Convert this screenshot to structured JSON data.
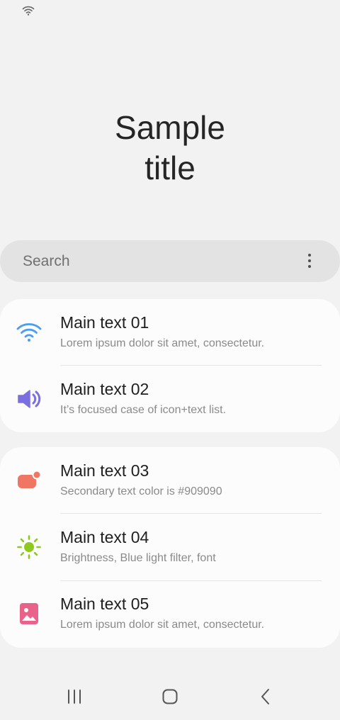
{
  "header": {
    "title_line1": "Sample",
    "title_line2": "title"
  },
  "search": {
    "placeholder": "Search",
    "more_icon": "more-vert-icon"
  },
  "lists": [
    {
      "items": [
        {
          "icon": "wifi-icon",
          "icon_color": "#4a9df0",
          "main": "Main text 01",
          "sub": "Lorem ipsum dolor sit amet, consectetur."
        },
        {
          "icon": "volume-icon",
          "icon_color": "#7b6fe0",
          "main": "Main text 02",
          "sub": "It’s focused case of icon+text list."
        }
      ]
    },
    {
      "items": [
        {
          "icon": "notification-badge-icon",
          "icon_color": "#f07563",
          "main": "Main text 03",
          "sub": "Secondary text color is #909090"
        },
        {
          "icon": "brightness-icon",
          "icon_color": "#8fc91e",
          "main": "Main text 04",
          "sub": "Brightness, Blue light filter, font"
        },
        {
          "icon": "image-icon",
          "icon_color": "#e8628a",
          "main": "Main text 05",
          "sub": "Lorem ipsum dolor sit amet, consectetur."
        }
      ]
    }
  ],
  "colors": {
    "background": "#f2f2f2",
    "card": "#fcfcfc",
    "search_bg": "#e3e3e3",
    "secondary_text": "#909090"
  },
  "nav": {
    "recents_icon": "recents-icon",
    "home_icon": "home-icon",
    "back_icon": "back-icon"
  }
}
